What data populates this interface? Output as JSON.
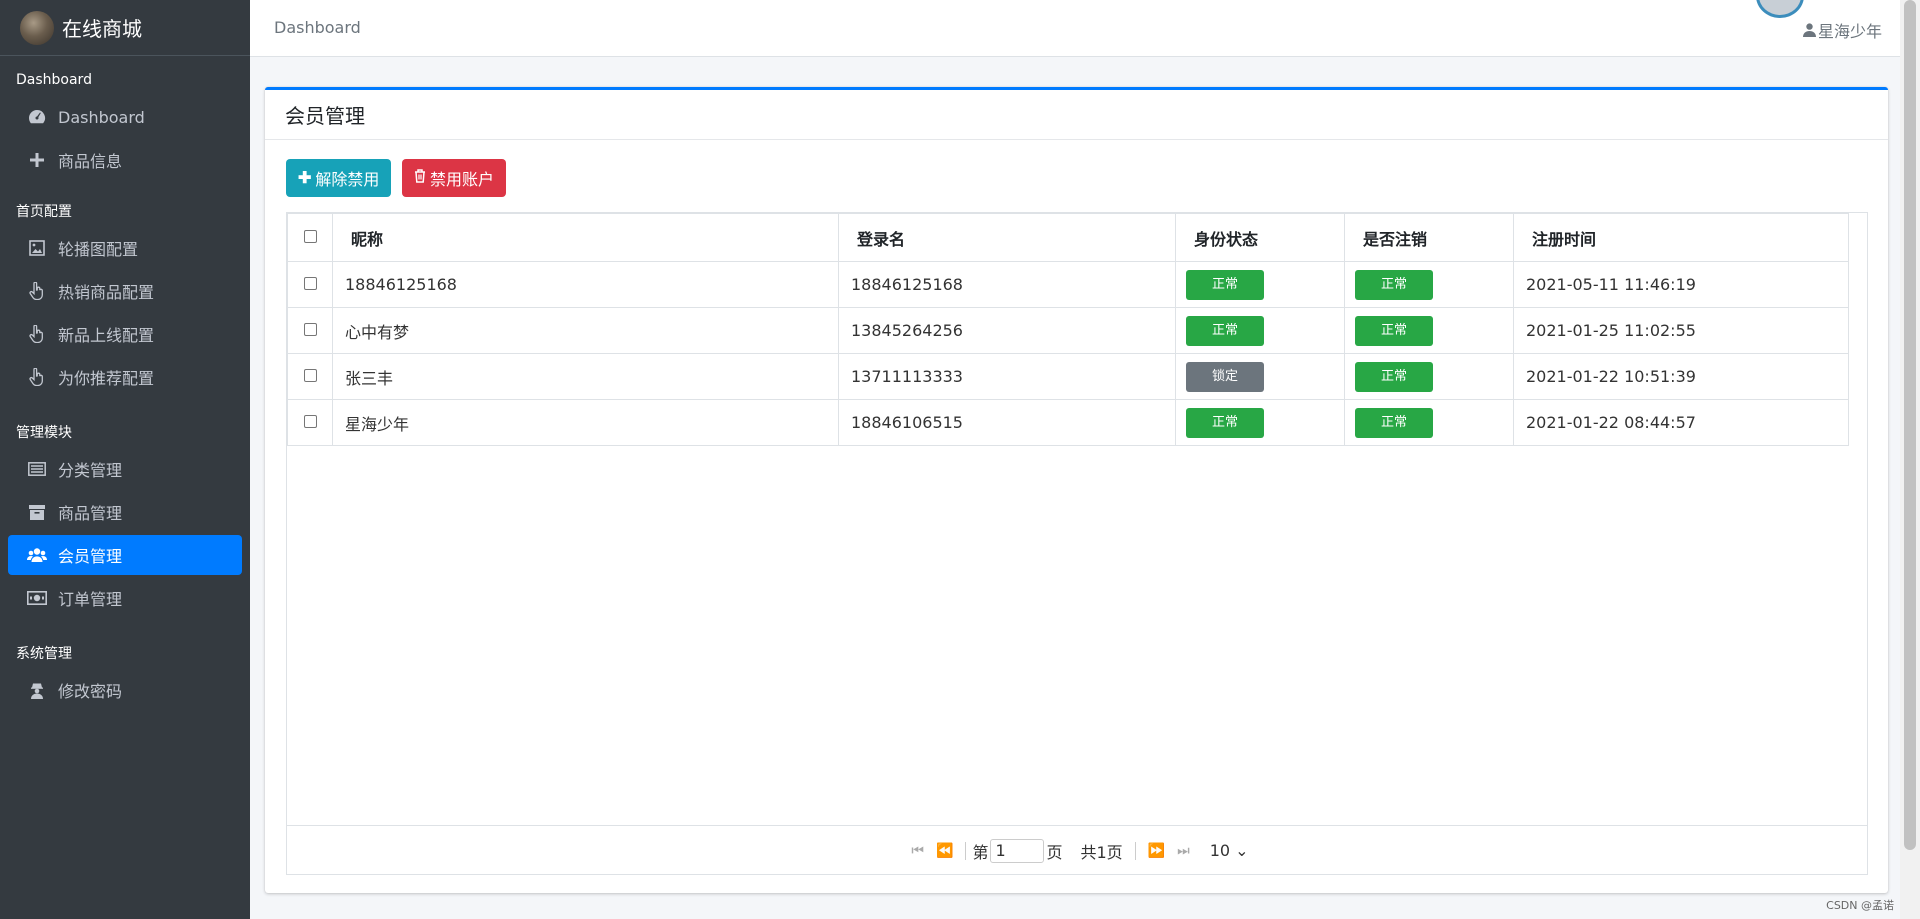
{
  "brand": {
    "title": "在线商城"
  },
  "sidebar": {
    "sections": [
      {
        "header": "Dashboard",
        "items": [
          {
            "label": "Dashboard",
            "icon": "dashboard-icon"
          },
          {
            "label": "商品信息",
            "icon": "plus-icon"
          }
        ]
      },
      {
        "header": "首页配置",
        "items": [
          {
            "label": "轮播图配置",
            "icon": "image-icon"
          },
          {
            "label": "热销商品配置",
            "icon": "hand-pointer-icon"
          },
          {
            "label": "新品上线配置",
            "icon": "hand-pointer-icon"
          },
          {
            "label": "为你推荐配置",
            "icon": "hand-pointer-icon"
          }
        ]
      },
      {
        "header": "管理模块",
        "items": [
          {
            "label": "分类管理",
            "icon": "list-icon"
          },
          {
            "label": "商品管理",
            "icon": "archive-icon"
          },
          {
            "label": "会员管理",
            "icon": "users-icon",
            "active": true
          },
          {
            "label": "订单管理",
            "icon": "money-icon"
          }
        ]
      },
      {
        "header": "系统管理",
        "items": [
          {
            "label": "修改密码",
            "icon": "user-secret-icon"
          }
        ]
      }
    ]
  },
  "topbar": {
    "breadcrumb": "Dashboard",
    "username": "星海少年"
  },
  "card": {
    "title": "会员管理",
    "btn_enable": "解除禁用",
    "btn_disable": "禁用账户"
  },
  "table": {
    "headers": {
      "nickname": "昵称",
      "login": "登录名",
      "status": "身份状态",
      "cancel": "是否注销",
      "time": "注册时间"
    },
    "rows": [
      {
        "nickname": "18846125168",
        "login": "18846125168",
        "status": "正常",
        "cancel": "正常",
        "time": "2021-05-11 11:46:19"
      },
      {
        "nickname": "心中有梦",
        "login": "13845264256",
        "status": "正常",
        "cancel": "正常",
        "time": "2021-01-25 11:02:55"
      },
      {
        "nickname": "张三丰",
        "login": "13711113333",
        "status": "锁定",
        "cancel": "正常",
        "time": "2021-01-22 10:51:39"
      },
      {
        "nickname": "星海少年",
        "login": "18846106515",
        "status": "正常",
        "cancel": "正常",
        "time": "2021-01-22 08:44:57"
      }
    ]
  },
  "pager": {
    "page_prefix": "第",
    "page_value": "1",
    "page_suffix": "页",
    "total": "共1页",
    "page_size": "10"
  },
  "watermark": "CSDN @孟诺",
  "colors": {
    "sidebar": "#343a40",
    "accent": "#007bff",
    "info": "#17a2b8",
    "danger": "#dc3545",
    "success": "#28a745",
    "secondary": "#6c757d"
  }
}
